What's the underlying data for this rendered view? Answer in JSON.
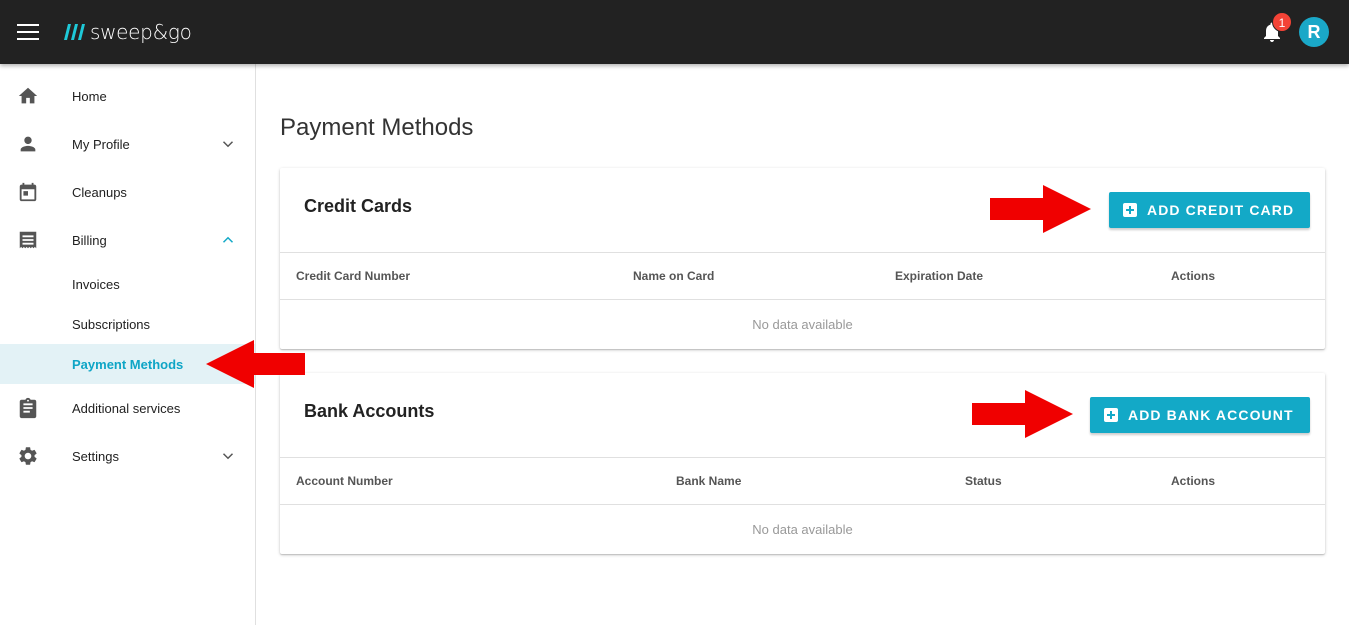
{
  "topbar": {
    "logo_text": "sweep&go",
    "notification_count": "1",
    "avatar_initial": "R"
  },
  "sidebar": {
    "items": [
      {
        "label": "Home",
        "icon": "home-icon"
      },
      {
        "label": "My Profile",
        "icon": "person-icon",
        "chevron": "down"
      },
      {
        "label": "Cleanups",
        "icon": "calendar-icon"
      },
      {
        "label": "Billing",
        "icon": "receipt-icon",
        "chevron": "up"
      },
      {
        "label": "Additional services",
        "icon": "clipboard-icon"
      },
      {
        "label": "Settings",
        "icon": "gear-icon",
        "chevron": "down"
      }
    ],
    "billing_sub": [
      {
        "label": "Invoices"
      },
      {
        "label": "Subscriptions"
      },
      {
        "label": "Payment Methods",
        "active": true
      }
    ]
  },
  "main": {
    "title": "Payment Methods",
    "credit_cards": {
      "title": "Credit Cards",
      "button_label": "ADD CREDIT CARD",
      "columns": [
        "Credit Card Number",
        "Name on Card",
        "Expiration Date",
        "Actions"
      ],
      "empty_text": "No data available"
    },
    "bank_accounts": {
      "title": "Bank Accounts",
      "button_label": "ADD BANK ACCOUNT",
      "columns": [
        "Account Number",
        "Bank Name",
        "Status",
        "Actions"
      ],
      "empty_text": "No data available"
    }
  },
  "colors": {
    "accent": "#13a9c7",
    "topbar": "#222222",
    "annotation_arrow": "#f00000",
    "badge": "#f44336"
  }
}
